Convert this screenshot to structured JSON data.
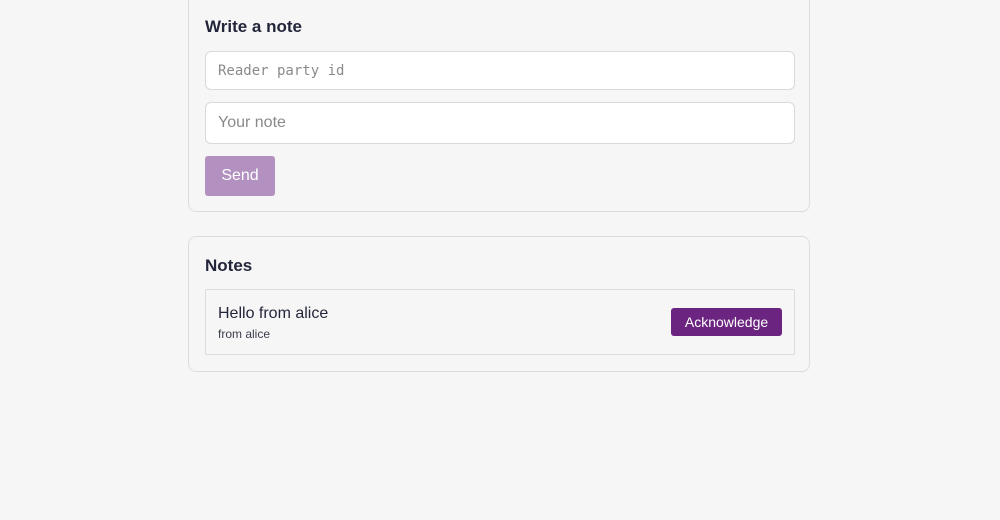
{
  "write": {
    "title": "Write a note",
    "party_placeholder": "Reader party id",
    "party_value": "",
    "note_placeholder": "Your note",
    "note_value": "",
    "send_label": "Send"
  },
  "notes": {
    "title": "Notes",
    "items": [
      {
        "body": "Hello from alice",
        "from": "from alice",
        "action_label": "Acknowledge"
      }
    ]
  },
  "colors": {
    "accent": "#6b2580",
    "accent_disabled": "#b291c0",
    "background": "#f6f6f6"
  }
}
